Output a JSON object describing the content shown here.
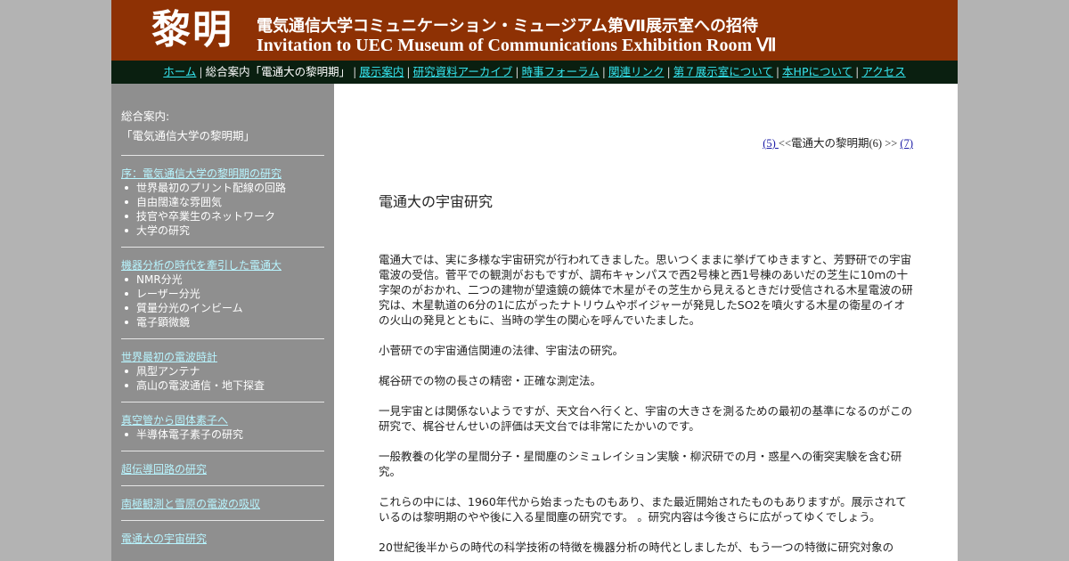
{
  "banner": {
    "kanji": "黎明",
    "title_jp": "電気通信大学コミュニケーション・ミュージアム第Ⅶ展示室への招待",
    "title_en": "Invitation to UEC Museum of Communications Exhibition Room Ⅶ"
  },
  "nav": {
    "home": "ホーム",
    "current": "総合案内「電通大の黎明期」",
    "exhibits": "展示案内",
    "archive": "研究資料アーカイブ",
    "forum": "時事フォーラム",
    "links": "関連リンク",
    "room7": "第７展示室について",
    "about": "本HPについて",
    "access": "アクセス"
  },
  "sidebar": {
    "lead1": "総合案内:",
    "lead2": "「電気通信大学の黎明期」",
    "sections": [
      {
        "title": "序：電気通信大学の黎明期の研究",
        "items": [
          "世界最初のプリント配線の回路",
          "自由闊達な雰囲気",
          "技官や卒業生のネットワーク",
          "大学の研究"
        ]
      },
      {
        "title": "機器分析の時代を牽引した電通大",
        "items": [
          "NMR分光",
          "レーザー分光",
          "質量分光のインビーム",
          "電子顕微鏡"
        ]
      },
      {
        "title": "世界最初の電波時計",
        "items": [
          "凧型アンテナ",
          "高山の電波通信・地下探査"
        ]
      },
      {
        "title": "真空管から固体素子へ",
        "items": [
          "半導体電子素子の研究"
        ]
      },
      {
        "title": "超伝導回路の研究",
        "items": []
      },
      {
        "title": "南極観測と雪原の電波の吸収",
        "items": []
      },
      {
        "title": "電通大の宇宙研究",
        "items": []
      }
    ]
  },
  "pager": {
    "prev": "(5) ",
    "middle": "<<電通大の黎明期(6) >> ",
    "next": "(7) "
  },
  "main": {
    "heading": "電通大の宇宙研究",
    "paragraphs": [
      "電通大では、実に多様な宇宙研究が行われてきました。思いつくままに挙げてゆきますと、芳野研での宇宙電波の受信。菅平での観測がおもですが、調布キャンパスで西2号棟と西1号棟のあいだの芝生に10ｍの十字架のがおかれ、二つの建物が望遠鏡の鏡体で木星がその芝生から見えるときだけ受信される木星電波の研究は、木星軌道の6分の1に広がったナトリウムやボイジャーが発見したSO2を噴火する木星の衛星のイオの火山の発見とともに、当時の学生の関心を呼んでいたました。",
      "小菅研での宇宙通信関連の法律、宇宙法の研究。",
      "梶谷研での物の長さの精密・正確な測定法。",
      "一見宇宙とは関係ないようですが、天文台へ行くと、宇宙の大きさを測るための最初の基準になるのがこの研究で、梶谷せんせいの評価は天文台では非常にたかいのです。",
      "一般教養の化学の星間分子・星間塵のシミュレイション実験・柳沢研での月・惑星への衝突実験を含む研究。",
      "これらの中には、1960年代から始まったものもあり、また最近開始されたものもありますが。展示されているのは黎明期のやや後に入る星間塵の研究です。 。研究内容は今後さらに広がってゆくでしょう。",
      "20世紀後半からの時代の科学技術の特徴を機器分析の時代としましたが、もう一つの特徴に研究対象の"
    ]
  }
}
